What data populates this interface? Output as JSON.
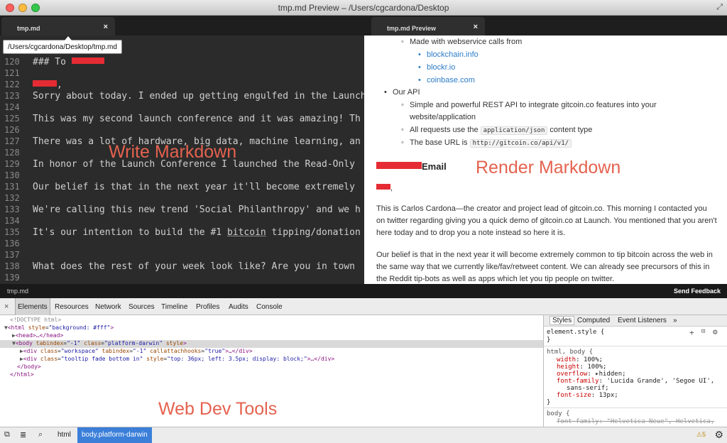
{
  "window": {
    "title": "tmp.md Preview – /Users/cgcardona/Desktop"
  },
  "tabs": {
    "editor": {
      "label": "tmp.md",
      "close": "×"
    },
    "preview": {
      "label": "tmp.md Preview",
      "close": "×"
    }
  },
  "tooltip": "/Users/cgcardona/Desktop/tmp.md",
  "editor": {
    "overlay_label": "Write Markdown",
    "lines": [
      {
        "n": "120",
        "text": "### To "
      },
      {
        "n": "121",
        "text": ""
      },
      {
        "n": "122",
        "text": ","
      },
      {
        "n": "123",
        "text": "Sorry about today. I ended up getting engulfed in the Launch"
      },
      {
        "n": "124",
        "text": ""
      },
      {
        "n": "125",
        "text": "This was my second launch conference and it was amazing! Th"
      },
      {
        "n": "126",
        "text": ""
      },
      {
        "n": "127",
        "text": "There was a lot of hardware, big data, machine learning, an"
      },
      {
        "n": "128",
        "text": ""
      },
      {
        "n": "129",
        "text": "In honor of the Launch Conference I launched the Read-Only"
      },
      {
        "n": "130",
        "text": ""
      },
      {
        "n": "131",
        "text": "Our belief is that in the next year it'll become extremely"
      },
      {
        "n": "132",
        "text": ""
      },
      {
        "n": "133",
        "text": "We're calling this new trend 'Social Philanthropy' and we h"
      },
      {
        "n": "134",
        "text": ""
      },
      {
        "n": "135",
        "text_before": "It's our intention to build the #1 ",
        "text_link": "bitcoin",
        "text_after": " tipping/donation"
      },
      {
        "n": "136",
        "text": ""
      },
      {
        "n": "137",
        "text": ""
      },
      {
        "n": "138",
        "text": "What does the rest of your week look like? Are you in town"
      },
      {
        "n": "139",
        "text": ""
      }
    ]
  },
  "preview": {
    "overlay_label": "Render Markdown",
    "made_with": "Made with webservice calls from",
    "links": [
      "blockchain.info",
      "blockr.io",
      "coinbase.com"
    ],
    "our_api": "Our API",
    "api_items": {
      "i1": "Simple and powerful REST API to integrate gitcoin.co features into your",
      "i1b": "website/application",
      "i2_before": "All requests use the ",
      "i2_code": "application/json",
      "i2_after": " content type",
      "i3_before": "The base URL is ",
      "i3_code": "http://gitcoin.co/api/v1/"
    },
    "email_heading": "Email",
    "salutation": ",",
    "para1": "This is Carlos Cardona—the creator and project lead of gitcoin.co. This morning I contacted you on twitter regarding giving you a quick demo of gitcoin.co at Launch. You mentioned that you aren't here today and to drop you a note instead so here it is.",
    "para2": "Our belief is that in the next year it will become extremely common to tip bitcoin across the web in the same way that we currently like/fav/retweet content. We can already see precursors of this in the Reddit tip-bots as well as apps which let you tip people on twitter."
  },
  "statusbar": {
    "file": "tmp.md",
    "feedback": "Send Feedback"
  },
  "devtools": {
    "overlay_label": "Web Dev Tools",
    "close": "×",
    "tabs": [
      "Elements",
      "Resources",
      "Network",
      "Sources",
      "Timeline",
      "Profiles",
      "Audits",
      "Console"
    ],
    "dom": {
      "doctype": "<!DOCTYPE html>",
      "html_open_tag": "<html",
      "html_attr": "style",
      "html_val": "\"background: #fff\"",
      "head": "<head>…</head>",
      "body_tag": "<body",
      "body_a1": "tabindex",
      "body_v1": "\"-1\"",
      "body_a2": "class",
      "body_v2": "\"platform-darwin\"",
      "body_a3": "style",
      "div1_tag": "<div",
      "div1_a1": "class",
      "div1_v1": "\"workspace\"",
      "div1_a2": "tabindex",
      "div1_v2": "\"-1\"",
      "div1_a3": "callattachhooks",
      "div1_v3": "\"true\"",
      "div1_end": ">…</div>",
      "div2_tag": "<div",
      "div2_a1": "class",
      "div2_v1": "\"tooltip fade bottom in\"",
      "div2_a2": "style",
      "div2_v2": "\"top: 36px; left: 3.5px; display: block;\"",
      "div2_end": ">…</div>",
      "body_close": "</body>",
      "html_close": "</html>"
    },
    "styles": {
      "tabs": [
        "Styles",
        "Computed",
        "Event Listeners"
      ],
      "more": "»",
      "element_style": "element.style {",
      "close_brace": "}",
      "selector1": "html, body {",
      "rules": [
        {
          "prop": "width",
          "val": "100%;"
        },
        {
          "prop": "height",
          "val": "100%;"
        },
        {
          "prop": "overflow",
          "val": "▸hidden;"
        },
        {
          "prop": "font-family",
          "val": "'Lucida Grande', 'Segoe UI',"
        },
        {
          "prop": "",
          "val": "sans-serif;"
        },
        {
          "prop": "font-size",
          "val": "13px;"
        }
      ],
      "selector2": "body {",
      "struck_rule": "font-family: \"Helvetica Neue\", Helvetica,"
    },
    "bottom": {
      "crumbs": [
        "html",
        "body.platform-darwin"
      ],
      "warnings": "⚠5"
    }
  }
}
